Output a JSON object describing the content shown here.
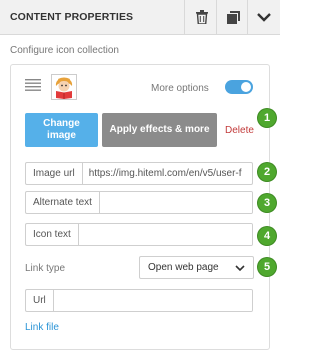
{
  "header": {
    "title": "CONTENT PROPERTIES",
    "icons": [
      "trash-icon",
      "copy-icon",
      "chevron-down-icon"
    ]
  },
  "subtitle": "Configure icon collection",
  "item": {
    "drag_icon": "drag-handle-icon",
    "thumbnail_icon": "user-reading-icon",
    "more_options_label": "More options",
    "more_options_on": true,
    "change_image_label": "Change image",
    "apply_effects_label": "Apply effects & more",
    "delete_label": "Delete",
    "image_url": {
      "label": "Image url",
      "value": "https://img.hiteml.com/en/v5/user-f"
    },
    "alternate_text": {
      "label": "Alternate text",
      "value": ""
    },
    "icon_text": {
      "label": "Icon text",
      "value": ""
    },
    "link_type": {
      "label": "Link type",
      "selected": "Open web page"
    },
    "url": {
      "label": "Url",
      "value": ""
    },
    "link_file_label": "Link file"
  },
  "badges": [
    "1",
    "2",
    "3",
    "4",
    "5"
  ],
  "colors": {
    "accent": "#55b0e9",
    "toggle": "#4aa3df",
    "badge": "#4fa82e",
    "delete": "#c23b3b",
    "link": "#2a94d6"
  }
}
